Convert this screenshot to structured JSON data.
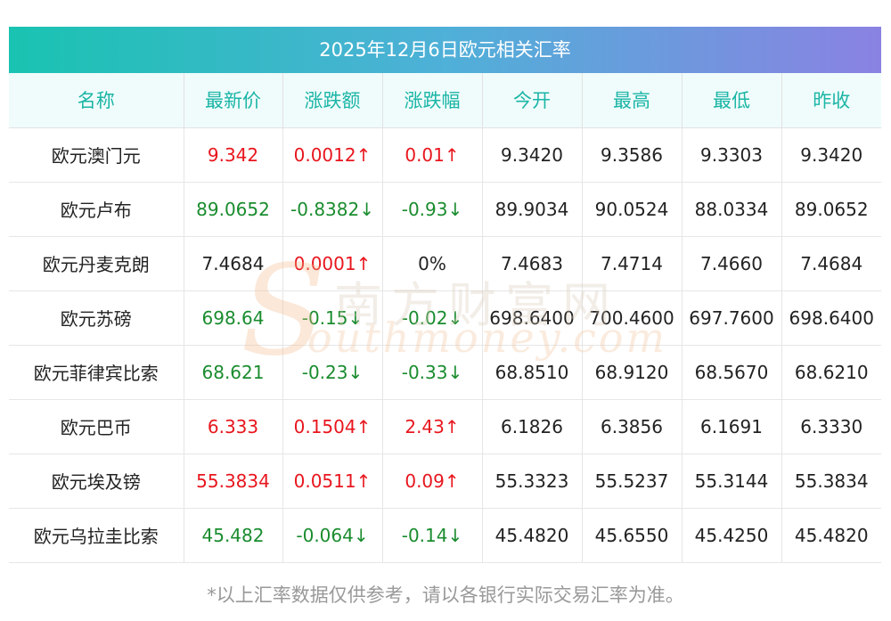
{
  "title": "2025年12月6日欧元相关汇率",
  "columns": [
    "名称",
    "最新价",
    "涨跌额",
    "涨跌幅",
    "今开",
    "最高",
    "最低",
    "昨收"
  ],
  "rows": [
    {
      "name": "欧元澳门元",
      "latest": "9.342",
      "change": "0.0012↑",
      "pct": "0.01↑",
      "open": "9.3420",
      "high": "9.3586",
      "low": "9.3303",
      "prev": "9.3420",
      "dir": "up",
      "pdir": "up"
    },
    {
      "name": "欧元卢布",
      "latest": "89.0652",
      "change": "-0.8382↓",
      "pct": "-0.93↓",
      "open": "89.9034",
      "high": "90.0524",
      "low": "88.0334",
      "prev": "89.0652",
      "dir": "down",
      "pdir": "down"
    },
    {
      "name": "欧元丹麦克朗",
      "latest": "7.4684",
      "change": "0.0001↑",
      "pct": "0%",
      "open": "7.4683",
      "high": "7.4714",
      "low": "7.4660",
      "prev": "7.4684",
      "dir": "flat-up",
      "pdir": "flat"
    },
    {
      "name": "欧元苏磅",
      "latest": "698.64",
      "change": "-0.15↓",
      "pct": "-0.02↓",
      "open": "698.6400",
      "high": "700.4600",
      "low": "697.7600",
      "prev": "698.6400",
      "dir": "down",
      "pdir": "down"
    },
    {
      "name": "欧元菲律宾比索",
      "latest": "68.621",
      "change": "-0.23↓",
      "pct": "-0.33↓",
      "open": "68.8510",
      "high": "68.9120",
      "low": "68.5670",
      "prev": "68.6210",
      "dir": "down",
      "pdir": "down"
    },
    {
      "name": "欧元巴币",
      "latest": "6.333",
      "change": "0.1504↑",
      "pct": "2.43↑",
      "open": "6.1826",
      "high": "6.3856",
      "low": "6.1691",
      "prev": "6.3330",
      "dir": "up",
      "pdir": "up"
    },
    {
      "name": "欧元埃及镑",
      "latest": "55.3834",
      "change": "0.0511↑",
      "pct": "0.09↑",
      "open": "55.3323",
      "high": "55.5237",
      "low": "55.3144",
      "prev": "55.3834",
      "dir": "up",
      "pdir": "up"
    },
    {
      "name": "欧元乌拉圭比索",
      "latest": "45.482",
      "change": "-0.064↓",
      "pct": "-0.14↓",
      "open": "45.4820",
      "high": "45.6550",
      "low": "45.4250",
      "prev": "45.4820",
      "dir": "down",
      "pdir": "down"
    }
  ],
  "watermark": {
    "cn": "南方财富网",
    "en": "outhmoney.com",
    "s": "S"
  },
  "note": "*以上汇率数据仅供参考，请以各银行实际交易汇率为准。",
  "colors": {
    "up": "#e8161e",
    "down": "#1a8c2e",
    "header_text": "#1bb5a6",
    "header_bg": "#effcfb"
  }
}
